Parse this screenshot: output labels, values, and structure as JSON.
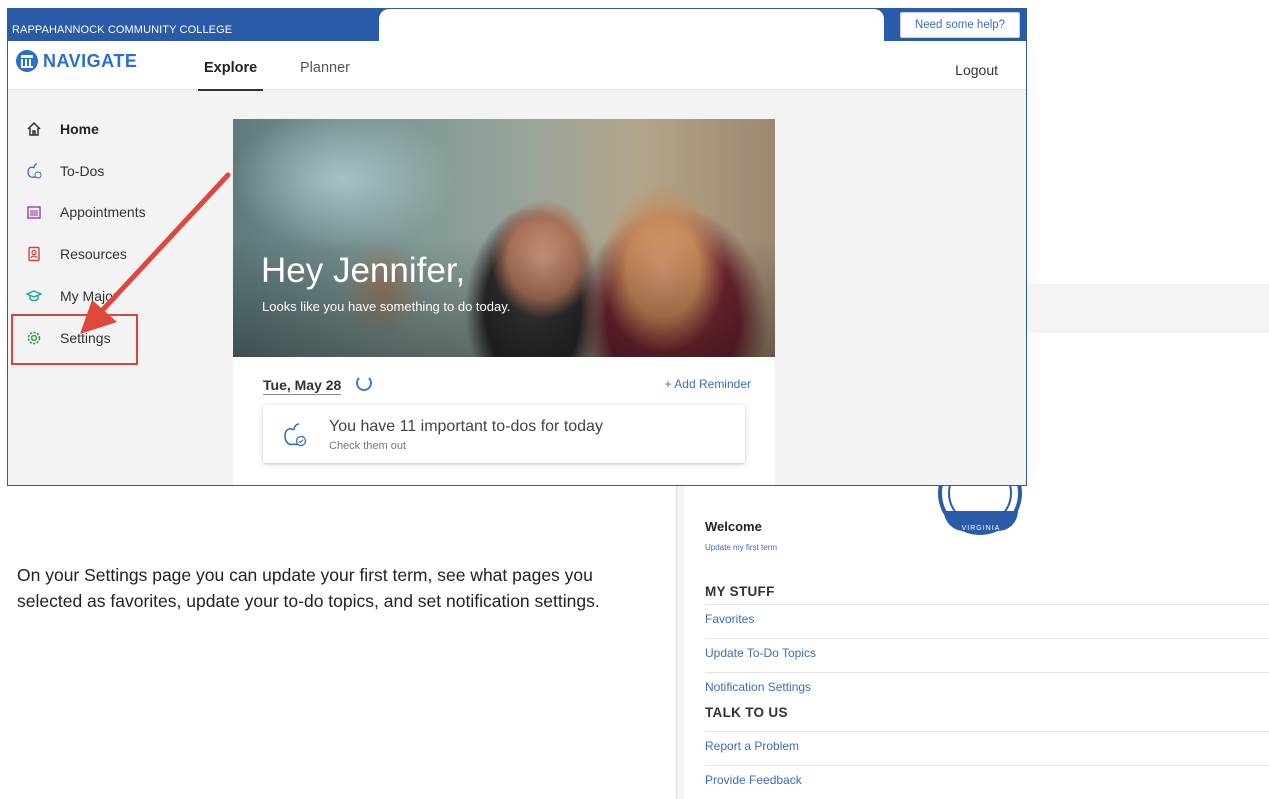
{
  "header": {
    "college_name": "RAPPAHANNOCK COMMUNITY COLLEGE",
    "help_label": "Need some help?"
  },
  "navbar": {
    "logo_text": "NAVIGATE",
    "tabs": [
      {
        "label": "Explore",
        "active": true
      },
      {
        "label": "Planner",
        "active": false
      }
    ],
    "logout_label": "Logout"
  },
  "sidebar": {
    "items": [
      {
        "label": "Home",
        "icon": "home-icon",
        "active": true
      },
      {
        "label": "To-Dos",
        "icon": "apple-check-icon"
      },
      {
        "label": "Appointments",
        "icon": "calendar-icon"
      },
      {
        "label": "Resources",
        "icon": "contact-book-icon"
      },
      {
        "label": "My Major",
        "icon": "graduation-cap-icon"
      },
      {
        "label": "Settings",
        "icon": "gear-icon"
      }
    ]
  },
  "hero": {
    "greeting": "Hey Jennifer,",
    "subtitle": "Looks like you have something to do today."
  },
  "today": {
    "date": "Tue, May 28",
    "add_reminder": "+ Add Reminder",
    "todo_title": "You have 11 important to-dos for today",
    "todo_sub": "Check them out"
  },
  "instruction": "On your Settings page you can update your first term, see what pages you selected as favorites, update your to-do topics, and set notification settings.",
  "settings_panel": {
    "seal_text": "VIRGINIA",
    "welcome": "Welcome",
    "update_first_term": "Update my first term",
    "sections": [
      {
        "title": "MY STUFF",
        "links": [
          "Favorites",
          "Update To-Do Topics",
          "Notification Settings"
        ]
      },
      {
        "title": "TALK TO US",
        "links": [
          "Report a Problem",
          "Provide Feedback"
        ]
      }
    ]
  },
  "colors": {
    "brand_blue": "#2a5ba8",
    "link_blue": "#3b6fb6",
    "highlight_red": "#d9443b"
  }
}
